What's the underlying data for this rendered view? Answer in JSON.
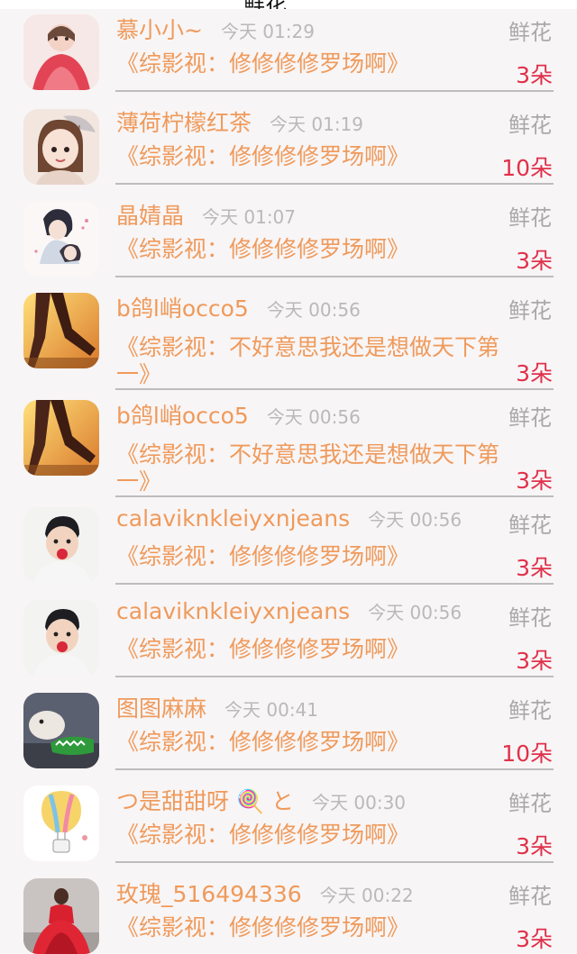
{
  "header": {
    "title": "鲜花"
  },
  "rows": [
    {
      "name": "慕小小~",
      "time": "今天 01:29",
      "gift": "鲜花",
      "book": "《综影视：修修修修罗场啊》",
      "count": "3朵",
      "avatar": "avatar-girl-red-dress"
    },
    {
      "name": "薄荷柠檬红茶",
      "time": "今天 01:19",
      "gift": "鲜花",
      "book": "《综影视：修修修修罗场啊》",
      "count": "10朵",
      "avatar": "avatar-girl-umbrella"
    },
    {
      "name": "晶婧晶",
      "time": "今天 01:07",
      "gift": "鲜花",
      "book": "《综影视：修修修修罗场啊》",
      "count": "3朵",
      "avatar": "avatar-anime-pair"
    },
    {
      "name": "b鸽l峭occo5",
      "time": "今天 00:56",
      "gift": "鲜花",
      "book": "《综影视：不好意思我还是想做天下第一》",
      "count": "3朵",
      "avatar": "avatar-walking-sunset"
    },
    {
      "name": "b鸽l峭occo5",
      "time": "今天 00:56",
      "gift": "鲜花",
      "book": "《综影视：不好意思我还是想做天下第一》",
      "count": "3朵",
      "avatar": "avatar-walking-sunset"
    },
    {
      "name": "calaviknkleiyxnjeans",
      "time": "今天 00:56",
      "gift": "鲜花",
      "book": "《综影视：修修修修罗场啊》",
      "count": "3朵",
      "avatar": "avatar-boy-flower"
    },
    {
      "name": "calaviknkleiyxnjeans",
      "time": "今天 00:56",
      "gift": "鲜花",
      "book": "《综影视：修修修修罗场啊》",
      "count": "3朵",
      "avatar": "avatar-boy-flower"
    },
    {
      "name": "图图麻麻",
      "time": "今天 00:41",
      "gift": "鲜花",
      "book": "《综影视：修修修修罗场啊》",
      "count": "10朵",
      "avatar": "avatar-dog-crocodile-toy"
    },
    {
      "name": "つ是甜甜呀 🍭 と",
      "time": "今天 00:30",
      "gift": "鲜花",
      "book": "《综影视：修修修修罗场啊》",
      "count": "3朵",
      "avatar": "avatar-hot-air-balloon"
    },
    {
      "name": "玫瑰_516494336",
      "time": "今天 00:22",
      "gift": "鲜花",
      "book": "《综影视：修修修修罗场啊》",
      "count": "3朵",
      "avatar": "avatar-woman-red-gown"
    }
  ]
}
